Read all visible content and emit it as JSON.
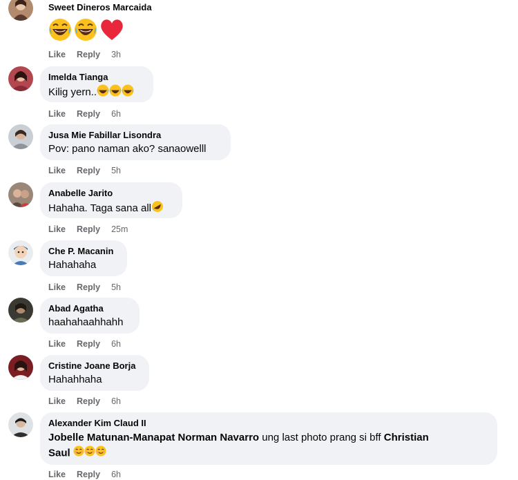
{
  "comments": [
    {
      "name": "Sweet Dineros Marcaida",
      "text": "",
      "like": "Like",
      "reply": "Reply",
      "time": "3h"
    },
    {
      "name": "Imelda Tianga",
      "text": "Kilig yern..",
      "like": "Like",
      "reply": "Reply",
      "time": "6h"
    },
    {
      "name": "Jusa Mie Fabillar Lisondra",
      "text": "Pov: pano naman ako? sanaowelll",
      "like": "Like",
      "reply": "Reply",
      "time": "5h"
    },
    {
      "name": "Anabelle Jarito",
      "text": "Hahaha. Taga sana all",
      "like": "Like",
      "reply": "Reply",
      "time": "25m"
    },
    {
      "name": "Che P. Macanin",
      "text": "Hahahaha",
      "like": "Like",
      "reply": "Reply",
      "time": "5h"
    },
    {
      "name": "Abad Agatha",
      "text": "haahahaahhahh",
      "like": "Like",
      "reply": "Reply",
      "time": "6h"
    },
    {
      "name": "Cristine Joane Borja",
      "text": "Hahahhaha",
      "like": "Like",
      "reply": "Reply",
      "time": "6h"
    },
    {
      "name": "Alexander Kim Claud II",
      "like": "Like",
      "reply": "Reply",
      "time": "6h",
      "mention1": "Jobelle Matunan-Manapat",
      "mention2": "Norman Navarro",
      "text_mid": " ung last photo prang si bff ",
      "mention3": "Christian",
      "mention3b": "Saul"
    }
  ],
  "colors": {
    "bubble": "#f0f2f5",
    "meta": "#65676b",
    "text": "#050505"
  },
  "icons": [
    "laughing-emoji",
    "heart-emoji",
    "rofl-emoji",
    "smiling-emoji"
  ]
}
